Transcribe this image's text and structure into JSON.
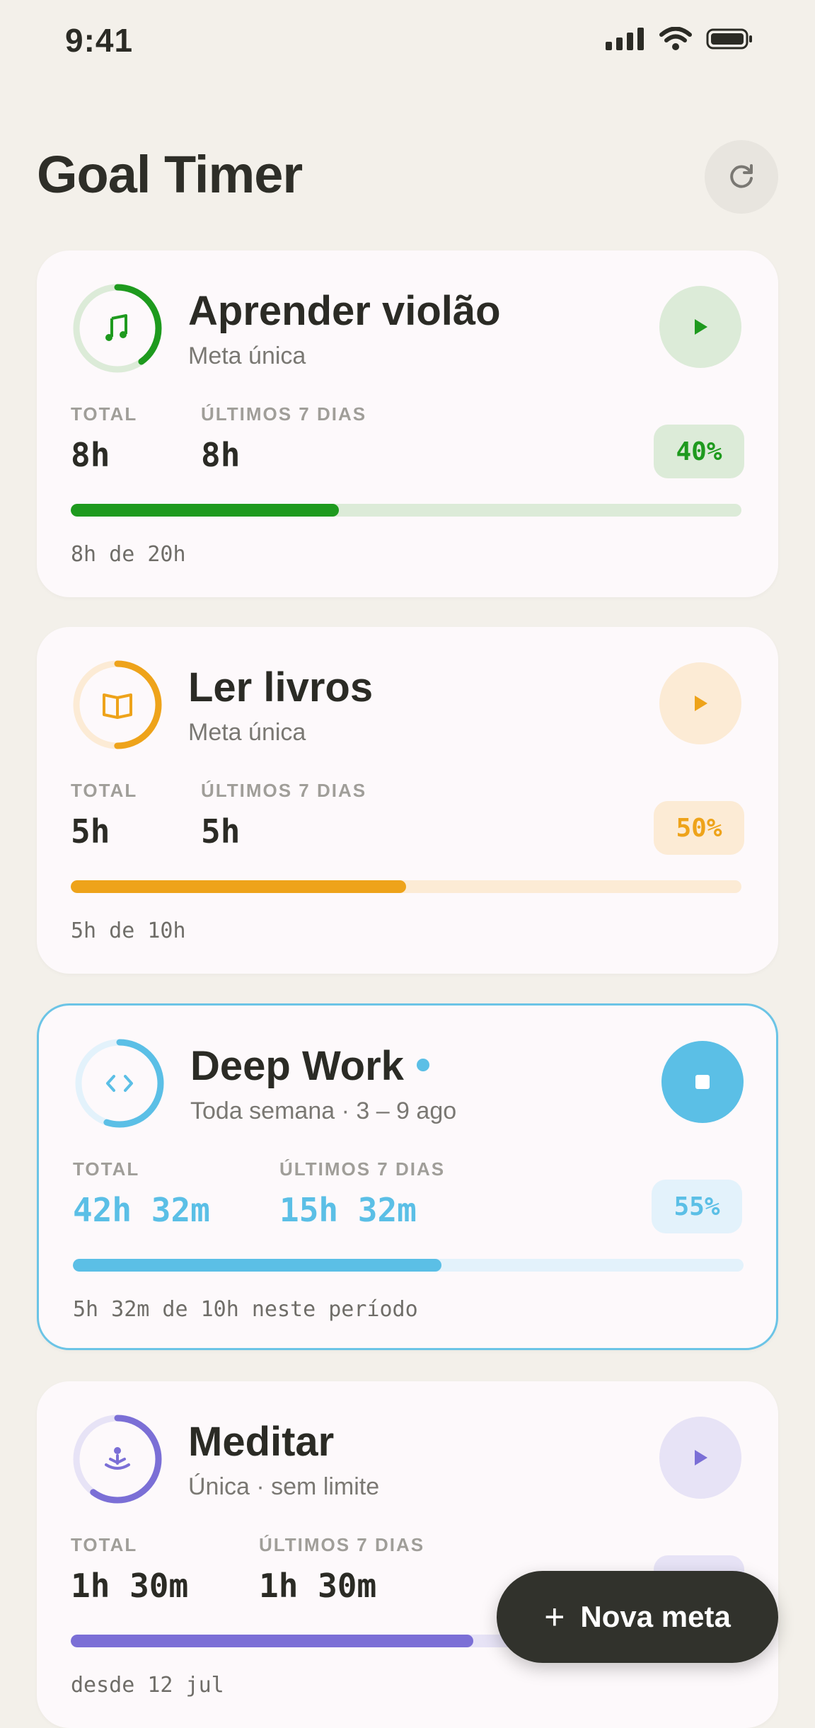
{
  "status_bar": {
    "time": "9:41"
  },
  "header": {
    "title": "Goal Timer",
    "refresh_icon": "refresh-icon"
  },
  "colors": {
    "background": "#f3f0ea",
    "green": "#1e9a1e",
    "green_soft": "#dcebd8",
    "orange": "#eea31a",
    "orange_soft": "#fcebd5",
    "blue": "#5bbfe6",
    "blue_soft": "#e3f2fb",
    "purple": "#7b6fd6",
    "purple_soft": "#e7e3f6"
  },
  "goals": [
    {
      "title": "Aprender violão",
      "subtitle": "Meta única",
      "icon": "music-note-icon",
      "total_label": "TOTAL",
      "total_value": "8h",
      "week_label": "ÚLTIMOS 7 DIAS",
      "week_value": "8h",
      "percent_label": "40%",
      "progress": 0.4,
      "caption": "8h de 20h",
      "action": "play"
    },
    {
      "title": "Ler livros",
      "subtitle": "Meta única",
      "icon": "book-icon",
      "total_label": "TOTAL",
      "total_value": "5h",
      "week_label": "ÚLTIMOS 7 DIAS",
      "week_value": "5h",
      "percent_label": "50%",
      "progress": 0.5,
      "caption": "5h de 10h",
      "action": "play"
    },
    {
      "title": "Deep Work",
      "subtitle": "Toda semana · 3 – 9 ago",
      "icon": "code-icon",
      "total_label": "TOTAL",
      "total_value": "42h 32m",
      "week_label": "ÚLTIMOS 7 DIAS",
      "week_value": "15h 32m",
      "percent_label": "55%",
      "progress": 0.55,
      "caption": "5h 32m de 10h neste período",
      "action": "stop"
    },
    {
      "title": "Meditar",
      "subtitle": "Única · sem limite",
      "icon": "meditation-icon",
      "total_label": "TOTAL",
      "total_value": "1h 30m",
      "week_label": "ÚLTIMOS 7 DIAS",
      "week_value": "1h 30m",
      "progress": 0.6,
      "caption": "desde 12 jul",
      "action": "play"
    }
  ],
  "fab": {
    "label": "Nova meta",
    "icon": "plus-icon"
  }
}
